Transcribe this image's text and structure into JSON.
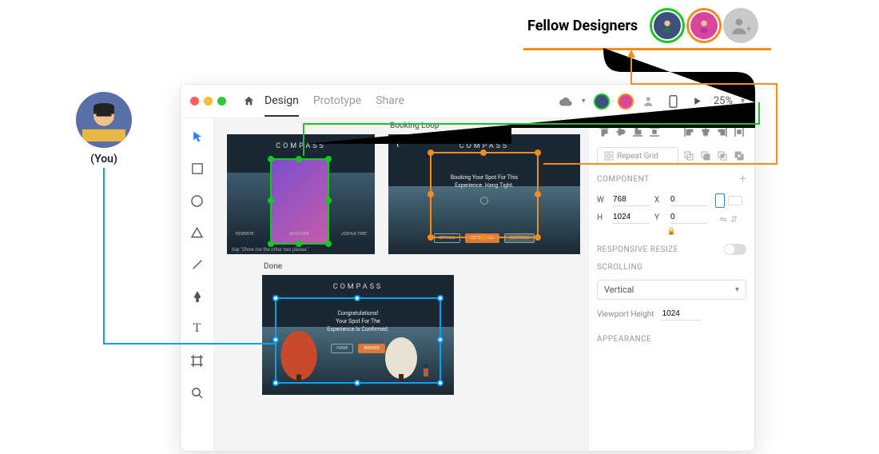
{
  "callout": {
    "fellow_label": "Fellow Designers",
    "you_label": "(You)"
  },
  "titlebar": {
    "tabs": [
      "Design",
      "Prototype",
      "Share"
    ],
    "active_tab": "Design",
    "zoom": "25%"
  },
  "tools": {
    "items": [
      "select",
      "rectangle",
      "ellipse",
      "polygon",
      "line",
      "pen",
      "text",
      "artboard",
      "zoom"
    ]
  },
  "artboards": {
    "ab1": {
      "label": "",
      "logo": "COMPASS",
      "footer": "Say \"Show me the other two please.\"",
      "thumbs": [
        "YOSEMITE",
        "ANTELOPE",
        "JOSHUA TREE"
      ]
    },
    "ab2": {
      "label": "Booking Loop",
      "logo": "COMPASS",
      "hero_line1": "Booking Your Spot For This",
      "hero_line2": "Experience. Hang Tight.",
      "pills": [
        "DETAILS",
        "EXPERIENCE",
        "CONTINUE"
      ]
    },
    "ab3": {
      "label": "Done",
      "logo": "COMPASS",
      "hero_line1": "Congratulations!",
      "hero_line2": "Your Spot For The",
      "hero_line3": "Experience Is Confirmed.",
      "pills": [
        "HOME",
        "BOOKED"
      ]
    }
  },
  "inspector": {
    "repeat_grid_label": "Repeat Grid",
    "component_label": "COMPONENT",
    "transform": {
      "w": "768",
      "h": "1024",
      "x": "0",
      "y": "0"
    },
    "responsive_label": "RESPONSIVE RESIZE",
    "scrolling_label": "SCROLLING",
    "scrolling_value": "Vertical",
    "viewport_height_label": "Viewport Height",
    "viewport_height_value": "1024",
    "appearance_label": "APPEARANCE"
  },
  "colors": {
    "green": "#16c624",
    "orange": "#f68b1e",
    "blue": "#00a2ff"
  }
}
